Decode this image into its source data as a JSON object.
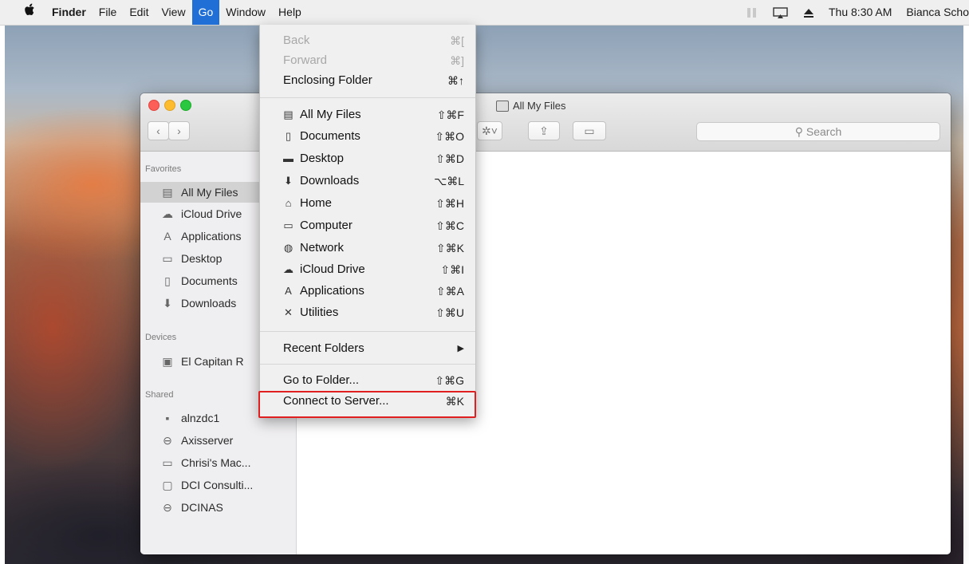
{
  "menubar": {
    "apple_icon": "apple-logo-icon",
    "app_name": "Finder",
    "menus": [
      "File",
      "Edit",
      "View",
      "Go",
      "Window",
      "Help"
    ],
    "active_menu": "Go",
    "clock": "Thu 8:30 AM",
    "user": "Bianca Scho"
  },
  "window": {
    "title": "All My Files",
    "search_placeholder": "Search"
  },
  "sidebar": {
    "favorites_heading": "Favorites",
    "favorites": [
      {
        "label": "All My Files",
        "icon": "all-files-icon",
        "selected": true
      },
      {
        "label": "iCloud Drive",
        "icon": "cloud-icon"
      },
      {
        "label": "Applications",
        "icon": "applications-icon"
      },
      {
        "label": "Desktop",
        "icon": "desktop-icon"
      },
      {
        "label": "Documents",
        "icon": "documents-icon"
      },
      {
        "label": "Downloads",
        "icon": "downloads-icon"
      }
    ],
    "devices_heading": "Devices",
    "devices": [
      {
        "label": "El Capitan R",
        "icon": "disk-icon"
      }
    ],
    "shared_heading": "Shared",
    "shared": [
      {
        "label": "alnzdc1",
        "icon": "server-icon"
      },
      {
        "label": "Axisserver",
        "icon": "nas-icon"
      },
      {
        "label": "Chrisi's Mac...",
        "icon": "laptop-icon"
      },
      {
        "label": "DCI Consulti...",
        "icon": "monitor-icon"
      },
      {
        "label": "DCINAS",
        "icon": "nas-icon"
      }
    ]
  },
  "go_menu": {
    "back": {
      "label": "Back",
      "shortcut": "⌘["
    },
    "forward": {
      "label": "Forward",
      "shortcut": "⌘]"
    },
    "enclosing": {
      "label": "Enclosing Folder",
      "shortcut": "⌘↑"
    },
    "places": [
      {
        "label": "All My Files",
        "shortcut": "⇧⌘F",
        "icon": "all-files-icon"
      },
      {
        "label": "Documents",
        "shortcut": "⇧⌘O",
        "icon": "documents-icon"
      },
      {
        "label": "Desktop",
        "shortcut": "⇧⌘D",
        "icon": "desktop-icon"
      },
      {
        "label": "Downloads",
        "shortcut": "⌥⌘L",
        "icon": "downloads-icon"
      },
      {
        "label": "Home",
        "shortcut": "⇧⌘H",
        "icon": "home-icon"
      },
      {
        "label": "Computer",
        "shortcut": "⇧⌘C",
        "icon": "computer-icon"
      },
      {
        "label": "Network",
        "shortcut": "⇧⌘K",
        "icon": "network-icon"
      },
      {
        "label": "iCloud Drive",
        "shortcut": "⇧⌘I",
        "icon": "cloud-icon"
      },
      {
        "label": "Applications",
        "shortcut": "⇧⌘A",
        "icon": "applications-icon"
      },
      {
        "label": "Utilities",
        "shortcut": "⇧⌘U",
        "icon": "utilities-icon"
      }
    ],
    "recent": {
      "label": "Recent Folders",
      "shortcut": "▶"
    },
    "goto": {
      "label": "Go to Folder...",
      "shortcut": "⇧⌘G"
    },
    "connect": {
      "label": "Connect to Server...",
      "shortcut": "⌘K"
    }
  },
  "colors": {
    "accent": "#1f6fd6",
    "highlight_box": "#e02020"
  }
}
